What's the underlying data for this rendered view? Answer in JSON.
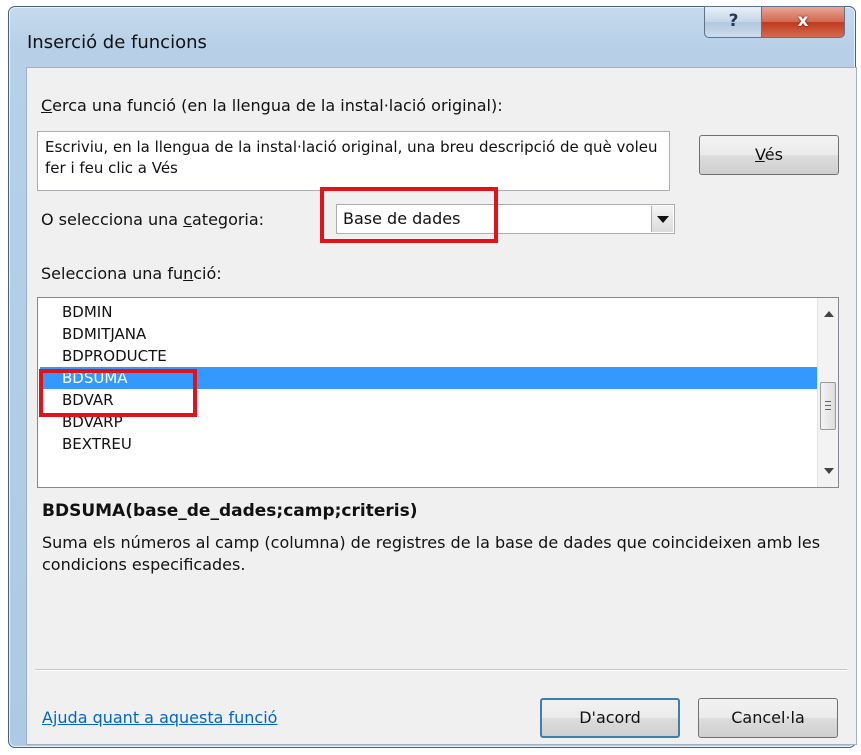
{
  "window": {
    "title": "Inserció de funcions",
    "help_label": "?",
    "close_label": "x"
  },
  "search": {
    "label_pre": "",
    "label_access": "C",
    "label_post": "erca una funció (en la llengua de la instal·lació original):",
    "description": "Escriviu, en la llengua de la instal·lació original, una breu descripció de què voleu fer i feu clic a Vés",
    "go_access": "V",
    "go_rest": "és"
  },
  "category": {
    "label_pre": "O selecciona una ",
    "label_access": "c",
    "label_post": "ategoria:",
    "selected": "Base de dades"
  },
  "function_list": {
    "label_pre": "Selecciona una fu",
    "label_access": "n",
    "label_post": "ció:",
    "items": [
      "BDMIN",
      "BDMITJANA",
      "BDPRODUCTE",
      "BDSUMA",
      "BDVAR",
      "BDVARP",
      "BEXTREU"
    ],
    "selected": "BDSUMA"
  },
  "details": {
    "signature": "BDSUMA(base_de_dades;camp;criteris)",
    "description": "Suma els números al camp (columna) de registres de la base de dades que coincideixen amb les condicions especificades."
  },
  "footer": {
    "help_link": "Ajuda quant a aquesta funció",
    "ok_label": "D'acord",
    "cancel_label": "Cancel·la"
  },
  "colors": {
    "highlight": "#e0121c",
    "selection": "#3399ff",
    "link": "#0066cc"
  }
}
